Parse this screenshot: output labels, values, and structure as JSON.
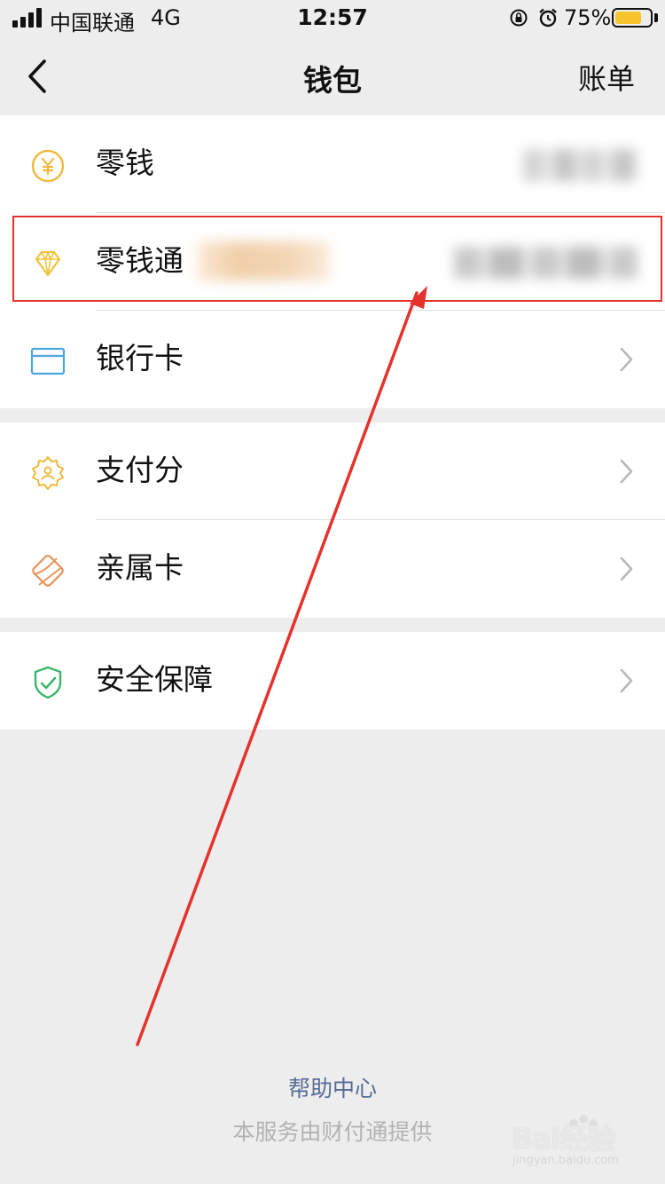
{
  "status_bar": {
    "carrier": "中国联通",
    "network": "4G",
    "time": "12:57",
    "battery_percent": "75%",
    "battery_level": 0.75,
    "battery_color": "#f5c32c"
  },
  "nav": {
    "title": "钱包",
    "right_action": "账单",
    "back_icon": "chevron-left-icon"
  },
  "wallet_items": [
    {
      "label": "零钱",
      "icon": "yen-coin-icon",
      "value": "blurred"
    },
    {
      "label": "零钱通",
      "icon": "diamond-icon",
      "value": "blurred",
      "highlighted": true
    },
    {
      "label": "银行卡",
      "icon": "bank-card-icon"
    }
  ],
  "service_items": [
    {
      "label": "支付分",
      "icon": "payment-score-badge-icon"
    },
    {
      "label": "亲属卡",
      "icon": "family-card-icon"
    }
  ],
  "security_items": [
    {
      "label": "安全保障",
      "icon": "shield-check-icon"
    }
  ],
  "footer": {
    "help_link": "帮助中心",
    "provider_note": "本服务由财付通提供"
  },
  "watermark": {
    "text": "Bai经验",
    "sub": "jingyan.baidu.com"
  },
  "colors": {
    "annotation_red": "#e5322d",
    "link_blue": "#576b95",
    "page_bg": "#ededed"
  }
}
